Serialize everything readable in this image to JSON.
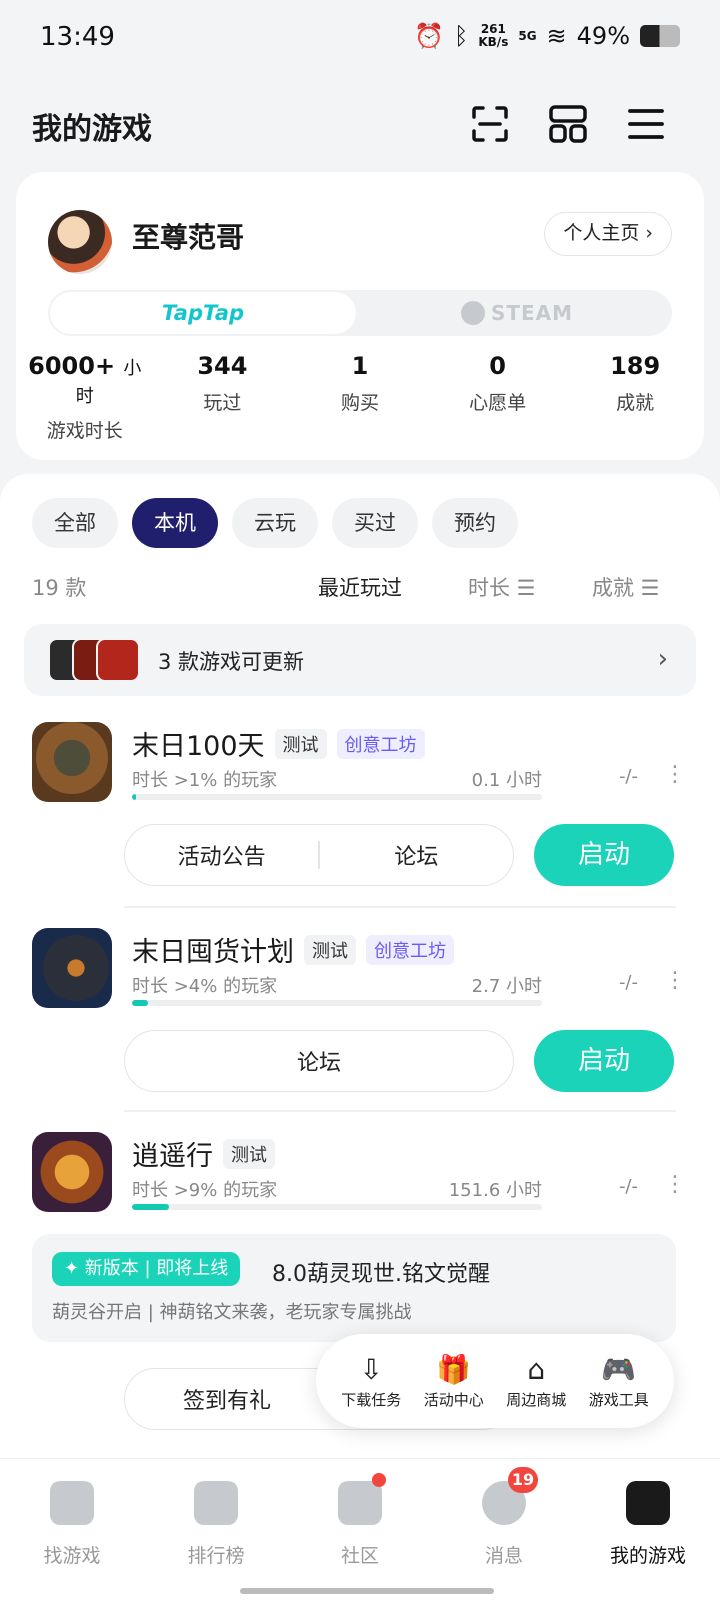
{
  "status_bar": {
    "time": "13:49",
    "net_speed_top": "261",
    "net_speed_bottom": "KB/s",
    "network": "5G",
    "battery": "49%"
  },
  "header": {
    "title": "我的游戏",
    "icons": [
      "scan-icon",
      "grid-icon",
      "menu-icon"
    ]
  },
  "profile": {
    "username": "至尊范哥",
    "homepage_label": "个人主页 ›",
    "platforms": {
      "taptap": "TapTap",
      "steam": "STEAM"
    },
    "stats": [
      {
        "value": "6000+",
        "unit": "小时",
        "label": "游戏时长"
      },
      {
        "value": "344",
        "unit": "",
        "label": "玩过"
      },
      {
        "value": "1",
        "unit": "",
        "label": "购买"
      },
      {
        "value": "0",
        "unit": "",
        "label": "心愿单"
      },
      {
        "value": "189",
        "unit": "",
        "label": "成就"
      }
    ]
  },
  "filters": {
    "tabs": [
      "全部",
      "本机",
      "云玩",
      "买过",
      "预约"
    ],
    "active": "本机"
  },
  "sort": {
    "count": "19 款",
    "recent": "最近玩过",
    "duration": "时长 ☰",
    "achievement": "成就 ☰"
  },
  "update_banner": {
    "text": "3 款游戏可更新"
  },
  "games": [
    {
      "name": "末日100天",
      "tags": [
        "测试",
        "创意工坊"
      ],
      "sub": "时长 >1% 的玩家",
      "hours": "0.1 小时",
      "achievement": "-/-",
      "progress": 0.01,
      "actions": [
        "活动公告",
        "论坛"
      ],
      "launch": "启动"
    },
    {
      "name": "末日囤货计划",
      "tags": [
        "测试",
        "创意工坊"
      ],
      "sub": "时长 >4% 的玩家",
      "hours": "2.7 小时",
      "achievement": "-/-",
      "progress": 0.04,
      "actions": [
        "论坛"
      ],
      "launch": "启动"
    },
    {
      "name": "逍遥行",
      "tags": [
        "测试"
      ],
      "sub": "时长 >9% 的玩家",
      "hours": "151.6 小时",
      "achievement": "-/-",
      "progress": 0.09,
      "actions": [
        "签到有礼"
      ]
    }
  ],
  "news": {
    "badge": "✦ 新版本 | 即将上线",
    "title": "8.0葫灵现世.铭文觉醒",
    "subtitle": "葫灵谷开启 | 神葫铭文来袭，老玩家专属挑战"
  },
  "float_toolbar": [
    {
      "icon": "download-icon",
      "glyph": "⇩",
      "label": "下载任务"
    },
    {
      "icon": "gift-icon",
      "glyph": "🎁",
      "label": "活动中心"
    },
    {
      "icon": "shop-icon",
      "glyph": "⌂",
      "label": "周边商城"
    },
    {
      "icon": "gamepad-icon",
      "glyph": "🎮",
      "label": "游戏工具"
    }
  ],
  "bottom_nav": [
    {
      "label": "找游戏",
      "icon": "discover-icon"
    },
    {
      "label": "排行榜",
      "icon": "ranking-icon"
    },
    {
      "label": "社区",
      "icon": "community-icon",
      "dot": true
    },
    {
      "label": "消息",
      "icon": "message-icon",
      "badge": "19"
    },
    {
      "label": "我的游戏",
      "icon": "my-games-icon",
      "active": true
    }
  ],
  "colors": {
    "accent": "#1bd3b8",
    "active_tab": "#1f1f6e",
    "tag_purple": "#6a5cf0",
    "badge_red": "#f2453d"
  }
}
